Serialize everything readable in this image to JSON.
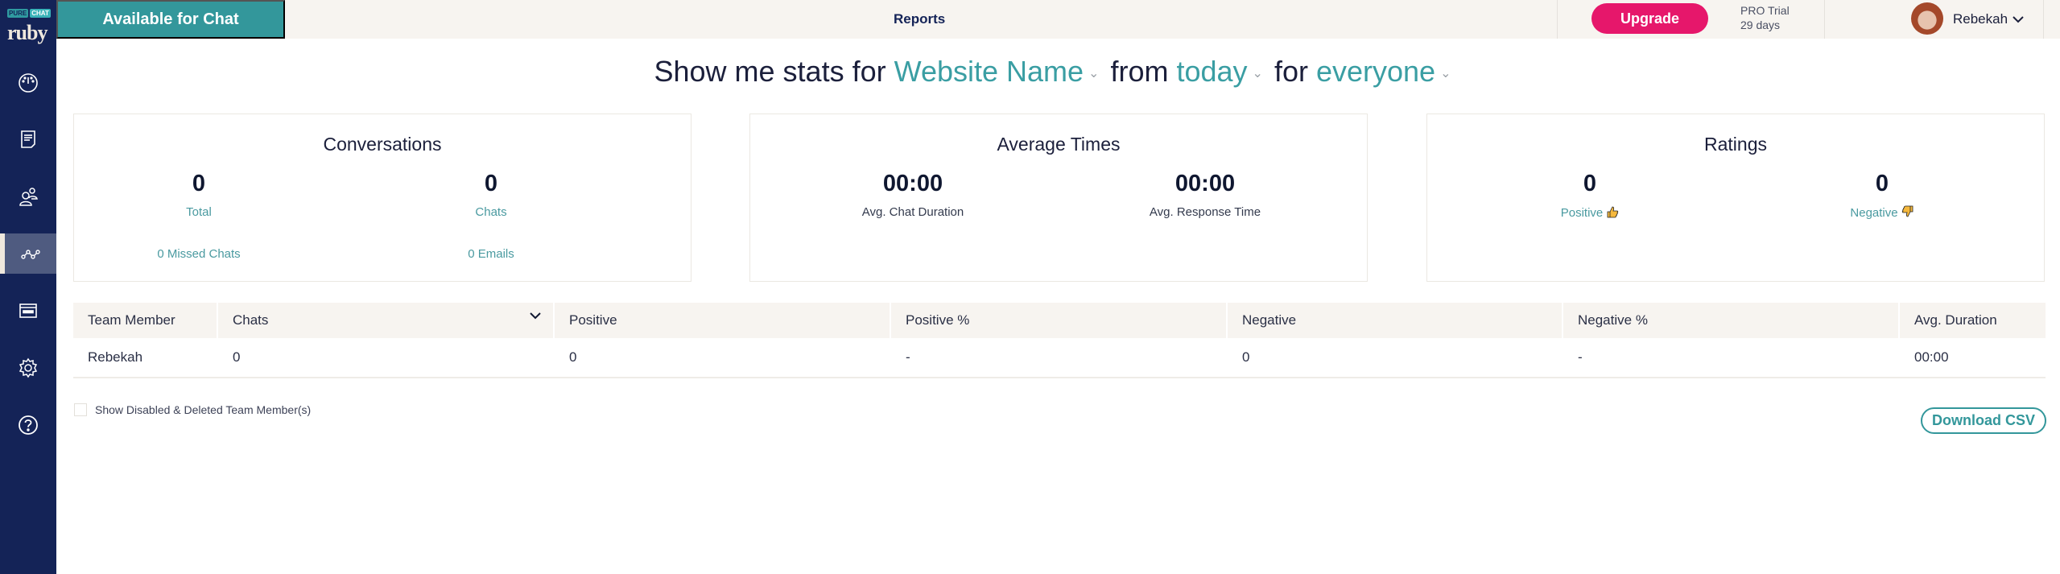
{
  "brand": {
    "logo_top_left": "PURE",
    "logo_top_right": "CHAT",
    "logo_bottom": "ruby"
  },
  "sidebar": {
    "items": [
      {
        "name": "dashboard",
        "icon": "speedometer-icon",
        "active": false
      },
      {
        "name": "transcripts",
        "icon": "document-icon",
        "active": false
      },
      {
        "name": "contacts",
        "icon": "users-icon",
        "active": false
      },
      {
        "name": "reports",
        "icon": "chart-line-icon",
        "active": true
      },
      {
        "name": "widgets",
        "icon": "browser-window-icon",
        "active": false
      },
      {
        "name": "settings",
        "icon": "gear-icon",
        "active": false
      },
      {
        "name": "help",
        "icon": "question-circle-icon",
        "active": false
      }
    ]
  },
  "topbar": {
    "status_button": "Available for Chat",
    "page_title": "Reports",
    "upgrade_label": "Upgrade",
    "trial_line1": "PRO Trial",
    "trial_line2": "29 days",
    "user_name": "Rebekah",
    "help_label": "?"
  },
  "filter": {
    "prefix": "Show me stats for",
    "website": "Website Name",
    "from_label": "from",
    "period": "today",
    "for_label": "for",
    "audience": "everyone",
    "caret": "⌄"
  },
  "cards": {
    "conversations": {
      "title": "Conversations",
      "total_value": "0",
      "total_label": "Total",
      "chats_value": "0",
      "chats_label": "Chats",
      "missed": "0 Missed Chats",
      "emails": "0 Emails"
    },
    "average_times": {
      "title": "Average Times",
      "duration_value": "00:00",
      "duration_label": "Avg. Chat Duration",
      "response_value": "00:00",
      "response_label": "Avg. Response Time"
    },
    "ratings": {
      "title": "Ratings",
      "positive_value": "0",
      "positive_label": "Positive",
      "negative_value": "0",
      "negative_label": "Negative"
    }
  },
  "table": {
    "columns": [
      "Team Member",
      "Chats",
      "Positive",
      "Positive %",
      "Negative",
      "Negative %",
      "Avg. Duration"
    ],
    "sort_indicator": "⌄",
    "rows": [
      [
        "Rebekah",
        "0",
        "0",
        "-",
        "0",
        "-",
        "00:00"
      ]
    ]
  },
  "footer": {
    "show_disabled_label": "Show Disabled & Deleted Team Member(s)",
    "show_disabled_checked": false,
    "download_label": "Download CSV"
  },
  "colors": {
    "teal": "#33979b",
    "navy": "#142357",
    "pink": "#e6176b",
    "cream": "#f7f4f0"
  }
}
